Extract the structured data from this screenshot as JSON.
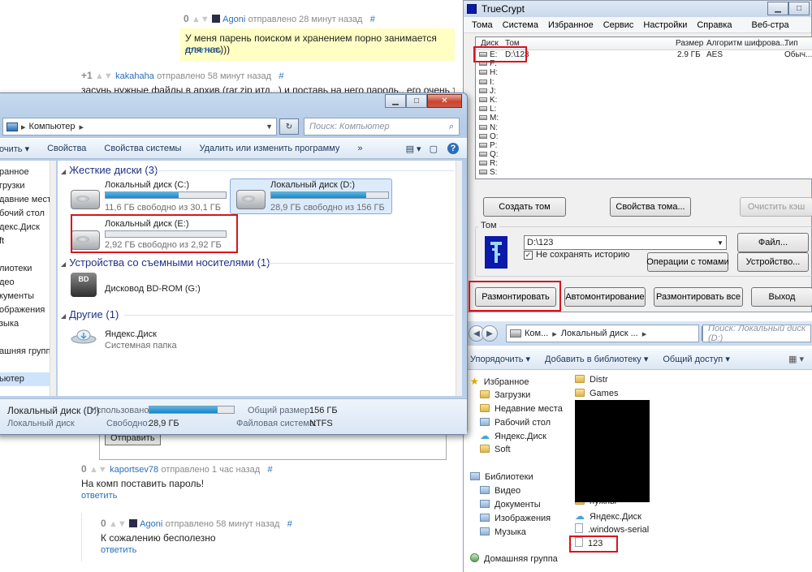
{
  "forum": {
    "c1": {
      "score": "0",
      "user": "Agoni",
      "meta": "отправлено 28 минут назад",
      "hash": "#",
      "text": "У меня парень поиском и хранением порно занимается для нас)))",
      "reply": "ответить"
    },
    "c2": {
      "score": "+1",
      "user": "kakahaha",
      "meta": "отправлено 58 минут назад",
      "hash": "#",
      "text": "засунь нужные файлы в архив (rar,zip итд...) и поставь на него пароль.. его очень трудно ломану"
    },
    "send_btn": "Отправить",
    "c3": {
      "score": "0",
      "user": "kaportsev78",
      "meta": "отправлено 1 час назад",
      "hash": "#",
      "text": "На комп поставить пароль!",
      "reply": "ответить"
    },
    "c4": {
      "score": "0",
      "user": "Agoni",
      "meta": "отправлено 58 минут назад",
      "hash": "#",
      "text": "К сожалению бесполезно",
      "reply": "ответить"
    }
  },
  "explorer_pc": {
    "breadcrumb": "Компьютер",
    "breadcrumb_sep": "▸",
    "search_placeholder": "Поиск: Компьютер",
    "commands": [
      "очить ▾",
      "Свойства",
      "Свойства системы",
      "Удалить или изменить программу",
      "»"
    ],
    "nav": [
      "ранное",
      "грузки",
      "давние места",
      "бочий стол",
      "декс.Диск",
      "ft",
      "",
      "лиотеки",
      "део",
      "кументы",
      "ображения",
      "зыка",
      "",
      "ашняя группа",
      "",
      "ьютер"
    ],
    "groups": {
      "hdd": "Жесткие диски (3)",
      "removable": "Устройства со съемными носителями (1)",
      "other": "Другие (1)"
    },
    "drives": [
      {
        "name": "Локальный диск (C:)",
        "free": "11,6 ГБ свободно из 30,1 ГБ",
        "used_fraction": 0.61
      },
      {
        "name": "Локальный диск (D:)",
        "free": "28,9 ГБ свободно из 156 ГБ",
        "used_fraction": 0.81
      },
      {
        "name": "Локальный диск (E:)",
        "free": "2,92 ГБ свободно из 2,92 ГБ",
        "used_fraction": 0.0
      }
    ],
    "bd": {
      "name": "Дисковод BD-ROM (G:)",
      "badge": "BD"
    },
    "yadisk": {
      "name": "Яндекс.Диск",
      "sub": "Системная папка"
    },
    "details": {
      "title": "Локальный диск (D:)",
      "type": "Локальный диск",
      "used_label": "Использовано:",
      "used_fraction": 0.81,
      "free_label": "Свободно:",
      "free_value": "28,9 ГБ",
      "total_label": "Общий размер:",
      "total_value": "156 ГБ",
      "fs_label": "Файловая система:",
      "fs_value": "NTFS"
    }
  },
  "truecrypt": {
    "title": "TrueCrypt",
    "menu": [
      "Тома",
      "Система",
      "Избранное",
      "Сервис",
      "Настройки",
      "Справка",
      "Веб-стра"
    ],
    "columns": {
      "disk": "Диск",
      "volume": "Том",
      "size": "Размер",
      "algo": "Алгоритм шифрова...",
      "type": "Тип"
    },
    "rows": [
      {
        "letter": "E:",
        "volume": "D:\\123",
        "size": "2.9 ГБ",
        "algo": "AES",
        "type": "Обыч..."
      },
      {
        "letter": "F:"
      },
      {
        "letter": "H:"
      },
      {
        "letter": "I:"
      },
      {
        "letter": "J:"
      },
      {
        "letter": "K:"
      },
      {
        "letter": "L:"
      },
      {
        "letter": "M:"
      },
      {
        "letter": "N:"
      },
      {
        "letter": "O:"
      },
      {
        "letter": "P:"
      },
      {
        "letter": "Q:"
      },
      {
        "letter": "R:"
      },
      {
        "letter": "S:"
      }
    ],
    "buttons": {
      "create": "Создать том",
      "props": "Свойства тома...",
      "clear": "Очистить кэш",
      "file": "Файл...",
      "ops": "Операции с томами",
      "device": "Устройство...",
      "dismount": "Размонтировать",
      "automount": "Автомонтирование",
      "dismount_all": "Размонтировать все",
      "exit": "Выход"
    },
    "volume_group": "Том",
    "volume_path": "D:\\123",
    "no_history": "Не сохранять историю",
    "no_history_checked": true
  },
  "explorer_d": {
    "breadcrumb": [
      "Ком...",
      "Локальный диск ...",
      ""
    ],
    "search_placeholder": "Поиск: Локальный диск (D:)",
    "commands": [
      "Упорядочить ▾",
      "Добавить в библиотеку ▾",
      "Общий доступ ▾"
    ],
    "view_icon": "view-icon",
    "tree": [
      {
        "label": "Избранное",
        "icon": "star"
      },
      {
        "label": "Загрузки",
        "icon": "folder"
      },
      {
        "label": "Недавние места",
        "icon": "folder"
      },
      {
        "label": "Рабочий стол",
        "icon": "lib"
      },
      {
        "label": "Яндекс.Диск",
        "icon": "cloud"
      },
      {
        "label": "Soft",
        "icon": "folder"
      },
      {
        "label": "Библиотеки",
        "icon": "lib"
      },
      {
        "label": "Видео",
        "icon": "lib"
      },
      {
        "label": "Документы",
        "icon": "lib"
      },
      {
        "label": "Изображения",
        "icon": "lib"
      },
      {
        "label": "Музыка",
        "icon": "lib"
      },
      {
        "label": "Домашняя группа",
        "icon": "net"
      }
    ],
    "files": [
      {
        "label": "Distr",
        "icon": "folder"
      },
      {
        "label": "Games",
        "icon": "folder"
      },
      {
        "label": "нужны",
        "icon": "folder"
      },
      {
        "label": "Яндекс.Диск",
        "icon": "cloud"
      },
      {
        "label": ".windows-serial",
        "icon": "file"
      },
      {
        "label": "123",
        "icon": "file"
      }
    ]
  },
  "colors": {
    "highlight": "#d8141e",
    "link": "#2a6ebb",
    "tc_logo": "#0b1aa8"
  }
}
